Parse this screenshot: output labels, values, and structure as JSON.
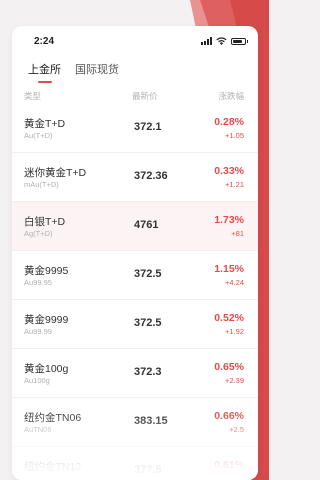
{
  "statusbar": {
    "time": "2:24"
  },
  "tabs": [
    {
      "label": "上金所",
      "active": true
    },
    {
      "label": "国际现货",
      "active": false
    }
  ],
  "columns": {
    "type": "类型",
    "latest": "最新价",
    "change": "涨跌幅"
  },
  "rows": [
    {
      "name": "黄金T+D",
      "code": "Au(T+D)",
      "price": "372.1",
      "pct": "0.28%",
      "chg": "+1.05"
    },
    {
      "name": "迷你黄金T+D",
      "code": "mAu(T+D)",
      "price": "372.36",
      "pct": "0.33%",
      "chg": "+1.21"
    },
    {
      "name": "白银T+D",
      "code": "Ag(T+D)",
      "price": "4761",
      "pct": "1.73%",
      "chg": "+81"
    },
    {
      "name": "黄金9995",
      "code": "Au99.95",
      "price": "372.5",
      "pct": "1.15%",
      "chg": "+4.24"
    },
    {
      "name": "黄金9999",
      "code": "Au99.99",
      "price": "372.5",
      "pct": "0.52%",
      "chg": "+1.92"
    },
    {
      "name": "黄金100g",
      "code": "Au100g",
      "price": "372.3",
      "pct": "0.65%",
      "chg": "+2.39"
    },
    {
      "name": "纽约金TN06",
      "code": "AuTN06",
      "price": "383.15",
      "pct": "0.66%",
      "chg": "+2.5"
    },
    {
      "name": "纽约金TN12",
      "code": "",
      "price": "377.5",
      "pct": "0.61%",
      "chg": ""
    }
  ],
  "colors": {
    "accent": "#e14b4b",
    "background_swoosh": "#d94848"
  }
}
